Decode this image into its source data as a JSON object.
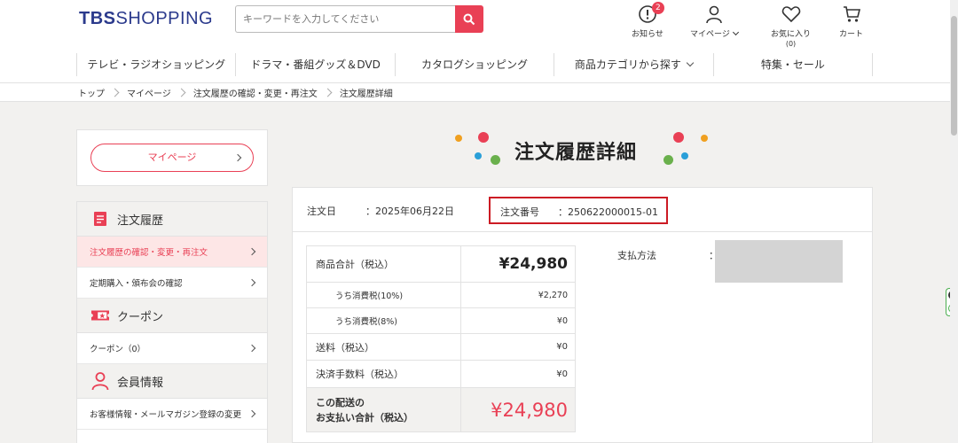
{
  "header": {
    "logo_tbs": "TBS",
    "logo_shopping": "SHOPPING",
    "search_placeholder": "キーワードを入力してください",
    "notice_label": "お知らせ",
    "notice_count": "2",
    "mypage_label": "マイページ",
    "favorite_label": "お気に入り",
    "favorite_count": "(0)",
    "cart_label": "カート"
  },
  "global_nav": [
    {
      "label": "テレビ・ラジオショッピング"
    },
    {
      "label": "ドラマ・番組グッズ＆DVD"
    },
    {
      "label": "カタログショッピング"
    },
    {
      "label": "商品カテゴリから探す"
    },
    {
      "label": "特集・セール"
    }
  ],
  "breadcrumb": [
    {
      "label": "トップ"
    },
    {
      "label": "マイページ"
    },
    {
      "label": "注文履歴の確認・変更・再注文"
    },
    {
      "label": "注文履歴詳細"
    }
  ],
  "sidebar": {
    "mypage_button": "マイページ",
    "sections": [
      {
        "title": "注文履歴",
        "icon": "document-icon",
        "items": [
          {
            "label": "注文履歴の確認・変更・再注文"
          },
          {
            "label": "定期購入・頒布会の確認"
          }
        ]
      },
      {
        "title": "クーポン",
        "icon": "coupon-icon",
        "items": [
          {
            "label": "クーポン（0）"
          }
        ]
      },
      {
        "title": "会員情報",
        "icon": "person-icon",
        "items": [
          {
            "label": "お客様情報・メールマガジン登録の変更"
          }
        ]
      }
    ]
  },
  "page": {
    "title": "注文履歴詳細",
    "order_date_label": "注文日",
    "order_date_value": "：2025年06月22日",
    "order_no_label": "注文番号",
    "order_no_value": "：250622000015-01",
    "payment_label": "支払方法",
    "payment_colon": "："
  },
  "price_table": {
    "rows": [
      {
        "label": "商品合計（税込）",
        "value": "¥24,980"
      },
      {
        "label": "うち消費税(10%)",
        "value": "¥2,270"
      },
      {
        "label": "うち消費税(8%)",
        "value": "¥0"
      },
      {
        "label": "送料（税込）",
        "value": "¥0"
      },
      {
        "label": "決済手数料（税込）",
        "value": "¥0"
      }
    ],
    "total_label_line1": "この配送の",
    "total_label_line2": "お支払い合計（税込）",
    "total_value": "¥24,980"
  },
  "colors": {
    "accent": "#e94055",
    "brand": "#2b3a8c",
    "highlight_border": "#cc1b24",
    "dot_red": "#e94055",
    "dot_orange": "#f0a020",
    "dot_blue": "#2a9fd8",
    "dot_green": "#6ab04c"
  }
}
